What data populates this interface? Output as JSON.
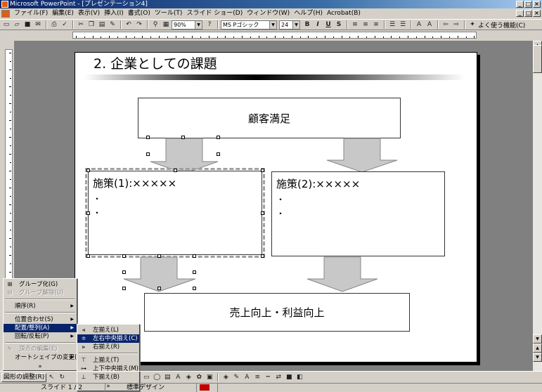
{
  "window": {
    "title": "Microsoft PowerPoint - [プレゼンテーション4]"
  },
  "menubar": {
    "items": [
      "ファイル(F)",
      "編集(E)",
      "表示(V)",
      "挿入(I)",
      "書式(O)",
      "ツール(T)",
      "スライド ショー(D)",
      "ウィンドウ(W)",
      "ヘルプ(H)",
      "Acrobat(B)"
    ]
  },
  "toolbar": {
    "zoom": "90%",
    "font_name": "MS Pゴシック",
    "font_size": "24",
    "common_tasks": "よく使う機能(C)"
  },
  "slide": {
    "title": "2. 企業としての課題",
    "box_top": "顧客満足",
    "box_left_title": "施策(1):×××××",
    "box_right_title": "施策(2):×××××",
    "bullet": "・",
    "box_bottom": "売上向上・利益向上"
  },
  "draw_menu": {
    "items": [
      "グループ化(G)",
      "グループ解除(U)",
      "順序(R)",
      "位置合わせ(S)",
      "配置/整列(A)",
      "回転/反転(P)",
      "頂点の編集(E)",
      "オートシェイプの変更(C)"
    ],
    "more": "»"
  },
  "align_submenu": {
    "items": [
      "左揃え(L)",
      "左右中央揃え(C)",
      "右揃え(R)",
      "上揃え(T)",
      "上下中央揃え(M)",
      "下揃え(B)"
    ],
    "more": "»"
  },
  "drawbar": {
    "label": "図形の調整(R)"
  },
  "status": {
    "slide": "スライド 1 / 2",
    "design": "標準デザイン"
  }
}
